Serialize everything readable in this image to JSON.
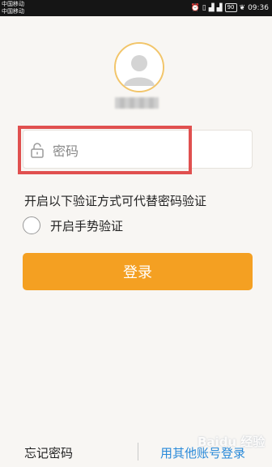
{
  "status_bar": {
    "carrier_1": "中国移动",
    "carrier_2": "中国移动",
    "battery": "90",
    "time": "09:36"
  },
  "login": {
    "password_placeholder": "密码",
    "alt_verify_title": "开启以下验证方式可代替密码验证",
    "gesture_label": "开启手势验证",
    "login_button": "登录",
    "forgot_password": "忘记密码",
    "other_account_login": "用其他账号登录"
  },
  "colors": {
    "accent": "#f4a022",
    "link": "#2a8ad9",
    "highlight": "#e0504f"
  },
  "icons": [
    "lock-icon",
    "avatar-icon"
  ],
  "watermark": "Baidu 经验"
}
